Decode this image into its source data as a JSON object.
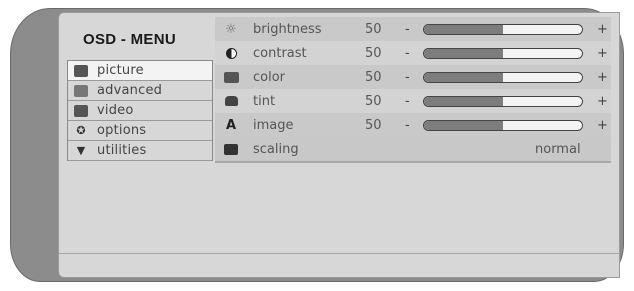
{
  "osd": {
    "title": "OSD - MENU"
  },
  "nav": {
    "items": [
      {
        "label": "picture",
        "icon": "monitor-icon",
        "active": true
      },
      {
        "label": "advanced",
        "icon": "advanced-icon",
        "active": false
      },
      {
        "label": "video",
        "icon": "video-camera-icon",
        "active": false
      },
      {
        "label": "options",
        "icon": "options-icon",
        "active": false
      },
      {
        "label": "utilities",
        "icon": "utilities-icon",
        "active": false
      }
    ]
  },
  "settings": {
    "rows": [
      {
        "label": "brightness",
        "value": "50",
        "level": 0.5,
        "icon": "sun-icon"
      },
      {
        "label": "contrast",
        "value": "50",
        "level": 0.5,
        "icon": "contrast-icon"
      },
      {
        "label": "color",
        "value": "50",
        "level": 0.5,
        "icon": "color-icon"
      },
      {
        "label": "tint",
        "value": "50",
        "level": 0.5,
        "icon": "tint-icon"
      },
      {
        "label": "image",
        "value": "50",
        "level": 0.5,
        "icon": "image-icon"
      }
    ],
    "scaling": {
      "label": "scaling",
      "value": "normal",
      "icon": "scaling-icon"
    },
    "minus_symbol": "-",
    "plus_symbol": "+"
  },
  "colors": {
    "bezel": "#8c8c8c",
    "screen": "#d7d7d7",
    "bar_fill": "#7d7d7d",
    "active_item": "#f3f3f3"
  }
}
